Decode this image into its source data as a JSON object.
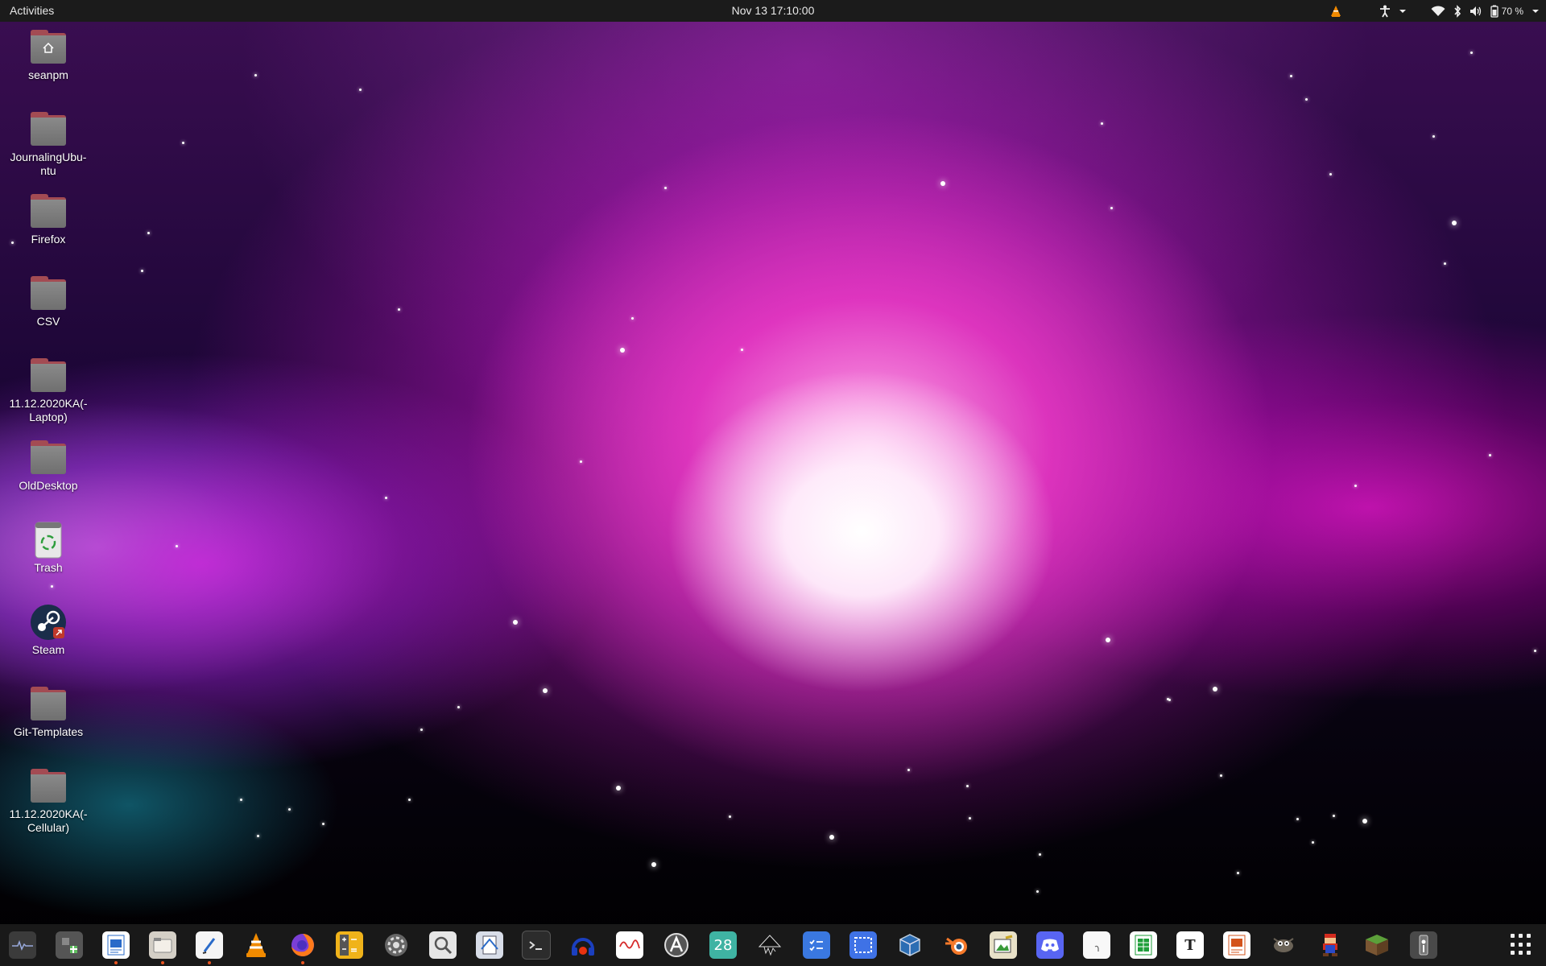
{
  "topbar": {
    "activities_label": "Activities",
    "clock": "Nov 13  17:10:00",
    "battery_percent": "70 %"
  },
  "desktop": {
    "icons": [
      {
        "label": "seanpm",
        "icon": "home-folder-icon"
      },
      {
        "label": "JournalingUbu-\nntu",
        "icon": "folder-icon"
      },
      {
        "label": "Firefox",
        "icon": "folder-icon"
      },
      {
        "label": "CSV",
        "icon": "folder-icon"
      },
      {
        "label": "11.12.2020KA(-\nLaptop)",
        "icon": "folder-icon"
      },
      {
        "label": "OldDesktop",
        "icon": "folder-icon"
      },
      {
        "label": "Trash",
        "icon": "trash-icon"
      },
      {
        "label": "Steam",
        "icon": "steam-icon"
      },
      {
        "label": "Git-Templates",
        "icon": "folder-icon"
      },
      {
        "label": "11.12.2020KA(-\nCellular)",
        "icon": "folder-icon"
      }
    ]
  },
  "dock": {
    "items": [
      {
        "icon": "system-monitor-icon",
        "running": false
      },
      {
        "icon": "extension-manager-icon",
        "running": false
      },
      {
        "icon": "libreoffice-writer-icon",
        "running": true
      },
      {
        "icon": "files-icon",
        "running": true
      },
      {
        "icon": "text-editor-icon",
        "running": true
      },
      {
        "icon": "vlc-icon",
        "running": false
      },
      {
        "icon": "firefox-icon",
        "running": true
      },
      {
        "icon": "calculator-icon",
        "running": false
      },
      {
        "icon": "settings-icon",
        "running": false
      },
      {
        "icon": "image-viewer-icon",
        "running": false
      },
      {
        "icon": "document-scanner-icon",
        "running": false
      },
      {
        "icon": "terminal-icon",
        "running": false
      },
      {
        "icon": "headphones-app-icon",
        "running": false
      },
      {
        "icon": "waveform-app-icon",
        "running": false
      },
      {
        "icon": "software-updater-icon",
        "running": false
      },
      {
        "icon": "calendar-icon",
        "running": false,
        "text": "28"
      },
      {
        "icon": "inkscape-icon",
        "running": false
      },
      {
        "icon": "todo-icon",
        "running": false
      },
      {
        "icon": "screenshot-icon",
        "running": false
      },
      {
        "icon": "virtualbox-icon",
        "running": false
      },
      {
        "icon": "blender-icon",
        "running": false
      },
      {
        "icon": "image-editor-icon",
        "running": false
      },
      {
        "icon": "discord-icon",
        "running": false
      },
      {
        "icon": "character-map-icon",
        "running": false
      },
      {
        "icon": "libreoffice-calc-icon",
        "running": false
      },
      {
        "icon": "typora-icon",
        "running": false,
        "text": "T"
      },
      {
        "icon": "libreoffice-impress-icon",
        "running": false
      },
      {
        "icon": "gimp-icon",
        "running": false
      },
      {
        "icon": "mario-game-icon",
        "running": false
      },
      {
        "icon": "minecraft-icon",
        "running": false
      },
      {
        "icon": "usb-drive-icon",
        "running": false
      }
    ],
    "show_apps_icon": "show-applications-icon"
  },
  "colors": {
    "topbar_bg": "#1b1b1b",
    "dock_bg": "#1e1e1e",
    "running_dot": "#e95420",
    "folder_accent": "#a34b53"
  }
}
